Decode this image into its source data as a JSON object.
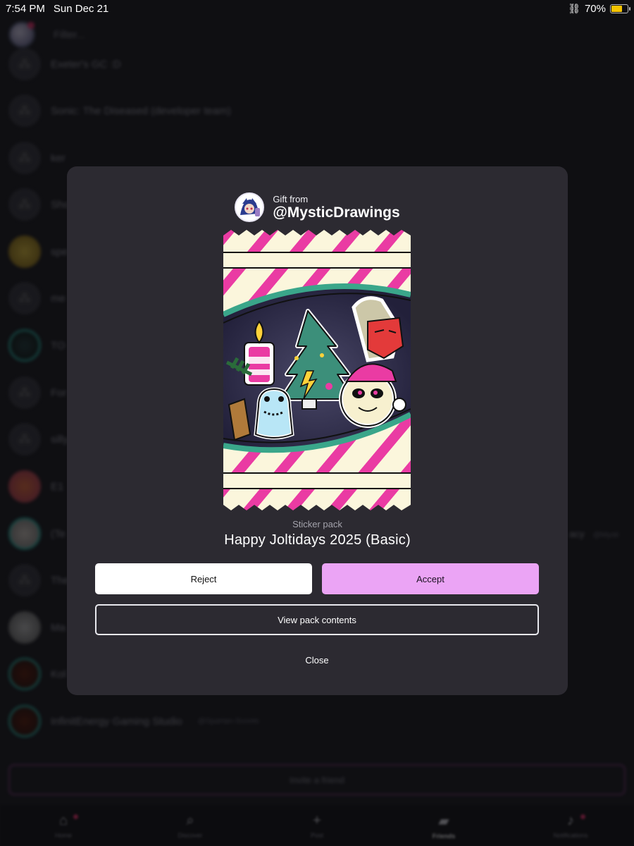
{
  "status_bar": {
    "time": "7:54 PM",
    "date": "Sun Dec 21",
    "battery_percent": "70%",
    "battery_level": 0.7
  },
  "list": {
    "filter_placeholder": "Filter...",
    "friends": [
      {
        "name": "Exeter's GC :D"
      },
      {
        "name": "Sonic: The Diseased (developer team)"
      },
      {
        "name": "ker"
      },
      {
        "name": "Sho"
      },
      {
        "name": "spe"
      },
      {
        "name": "me"
      },
      {
        "name": "TO"
      },
      {
        "name": "For"
      },
      {
        "name": "silly"
      },
      {
        "name": "E1"
      },
      {
        "name": "(Te"
      },
      {
        "name": "The"
      },
      {
        "name": "Ma"
      },
      {
        "name": "Kol"
      },
      {
        "name": "InfinitEnergy Gaming Studio",
        "sub": "@Spartan-Scoots"
      }
    ],
    "right_fragment": "acy",
    "right_fragment_sub": "@Mysti"
  },
  "invite_label": "Invite a friend",
  "tabs": [
    {
      "label": "Home",
      "icon": "home-icon"
    },
    {
      "label": "Discover",
      "icon": "search-icon"
    },
    {
      "label": "Post",
      "icon": "plus-icon"
    },
    {
      "label": "Friends",
      "icon": "chat-icon"
    },
    {
      "label": "Notifications",
      "icon": "bell-icon"
    }
  ],
  "dialog": {
    "gift_from_label": "Gift from",
    "sender_handle": "@MysticDrawings",
    "pack_type": "Sticker pack",
    "pack_title": "Happy Joltidays 2025 (Basic)",
    "reject_label": "Reject",
    "accept_label": "Accept",
    "view_contents_label": "View pack contents",
    "close_label": "Close"
  },
  "colors": {
    "dialog_bg": "#2c2a31",
    "accept_bg": "#eba4f5",
    "stripe_pink": "#ea3ba3",
    "pack_cream": "#fbf6dc",
    "teal_ribbon": "#3aa68a"
  }
}
